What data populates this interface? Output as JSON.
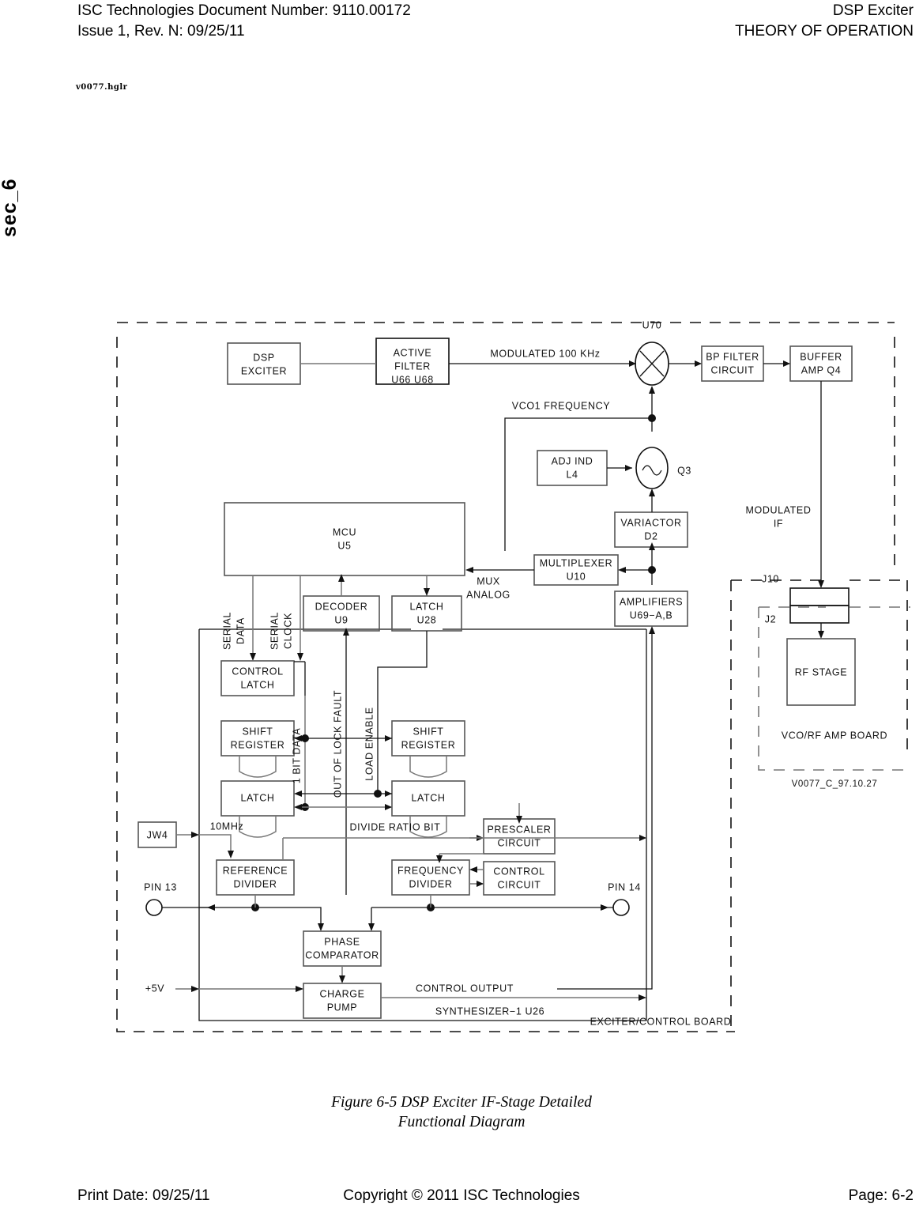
{
  "header": {
    "doc_number": "ISC Technologies Document Number: 9110.00172",
    "issue": "Issue 1, Rev. N: 09/25/11",
    "product": "DSP Exciter",
    "section": "THEORY OF OPERATION"
  },
  "file_tag": "v0077.hglr",
  "side_label": "sec_6",
  "caption": {
    "line1": "Figure 6-5 DSP Exciter IF-Stage Detailed",
    "line2": "Functional Diagram"
  },
  "footer": {
    "print_date": "Print Date: 09/25/11",
    "copyright": "Copyright © 2011 ISC Technologies",
    "page": "Page: 6-2"
  },
  "diagram": {
    "boards": {
      "exciter_control": "EXCITER/CONTROL  BOARD",
      "vco_rf_amp": "VCO/RF  AMP  BOARD",
      "drawing_id": "V0077_C_97.10.27",
      "synthesizer": "SYNTHESIZER−1  U26"
    },
    "blocks": {
      "dsp_exciter_l1": "DSP",
      "dsp_exciter_l2": "EXCITER",
      "active_filter_l1": "ACTIVE",
      "active_filter_l2": "FILTER",
      "active_filter_l3": "U66  U68",
      "bp_filter_l1": "BP  FILTER",
      "bp_filter_l2": "CIRCUIT",
      "buffer_amp_l1": "BUFFER",
      "buffer_amp_l2": "AMP  Q4",
      "adj_ind_l1": "ADJ  IND",
      "adj_ind_l2": "L4",
      "variactor_l1": "VARIACTOR",
      "variactor_l2": "D2",
      "multiplexer_l1": "MULTIPLEXER",
      "multiplexer_l2": "U10",
      "amplifiers_l1": "AMPLIFIERS",
      "amplifiers_l2": "U69−A,B",
      "mcu_l1": "MCU",
      "mcu_l2": "U5",
      "decoder_l1": "DECODER",
      "decoder_l2": "U9",
      "latch_u28_l1": "LATCH",
      "latch_u28_l2": "U28",
      "control_latch_l1": "CONTROL",
      "control_latch_l2": "LATCH",
      "shift_register_left_l1": "SHIFT",
      "shift_register_left_l2": "REGISTER",
      "shift_register_right_l1": "SHIFT",
      "shift_register_right_l2": "REGISTER",
      "latch_left": "LATCH",
      "latch_right": "LATCH",
      "reference_divider_l1": "REFERENCE",
      "reference_divider_l2": "DIVIDER",
      "frequency_divider_l1": "FREQUENCY",
      "frequency_divider_l2": "DIVIDER",
      "prescaler_l1": "PRESCALER",
      "prescaler_l2": "CIRCUIT",
      "control_circuit_l1": "CONTROL",
      "control_circuit_l2": "CIRCUIT",
      "phase_comparator_l1": "PHASE",
      "phase_comparator_l2": "COMPARATOR",
      "charge_pump_l1": "CHARGE",
      "charge_pump_l2": "PUMP",
      "rf_stage": "RF  STAGE",
      "jw4": "JW4"
    },
    "labels": {
      "u70": "U70",
      "q3": "Q3",
      "modulated_100khz": "MODULATED  100  KHz",
      "vco1_frequency": "VCO1  FREQUENCY",
      "modulated_if_l1": "MODULATED",
      "modulated_if_l2": "IF",
      "j10": "J10",
      "j2": "J2",
      "mux_l1": "MUX",
      "mux_l2": "ANALOG",
      "serial_data_l1": "SERIAL",
      "serial_data_l2": "DATA",
      "serial_clock_l1": "SERIAL",
      "serial_clock_l2": "CLOCK",
      "one_bit_data": "1  BIT  DATA",
      "out_of_lock_fault": "OUT  OF  LOCK  FAULT",
      "load_enable": "LOAD  ENABLE",
      "ten_mhz": "10MHz",
      "divide_ratio_bit": "DIVIDE   RATIO  BIT",
      "pin13": "PIN  13",
      "pin14": "PIN  14",
      "plus5v": "+5V",
      "control_output": "CONTROL  OUTPUT"
    }
  }
}
